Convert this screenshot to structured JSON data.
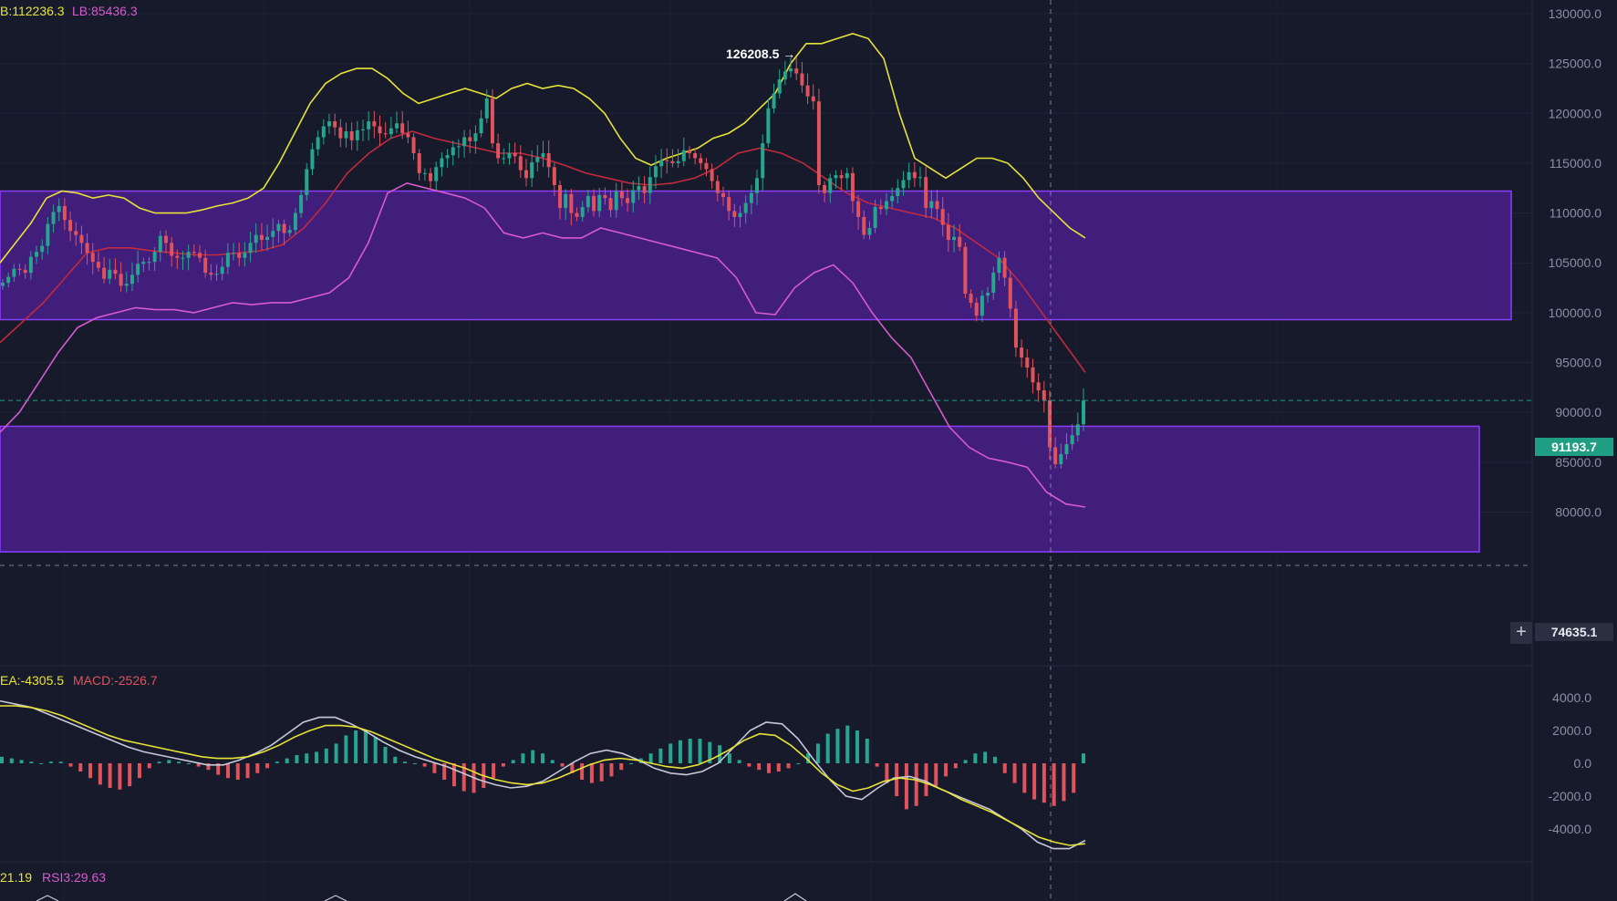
{
  "indicators": {
    "boll_label_ub": "B:112236.3",
    "boll_label_lb": "LB:85436.3",
    "macd_label_dea": "EA:-4305.5",
    "macd_label_macd": "MACD:-2526.7",
    "rsi_label_1": "21.19",
    "rsi_label_2": "RSI3:29.63"
  },
  "annotations": {
    "high_marker": "126208.5 →"
  },
  "price_tags": {
    "current_price": "91193.7",
    "crosshair_price": "74635.1",
    "crosshair_icon": "plus-icon"
  },
  "colors": {
    "background": "#161a2b",
    "up_candle": "#26a68e",
    "down_candle": "#e0525c",
    "upper_band": "#e8e337",
    "lower_band": "#d65ad0",
    "mid_band": "#c22a3e",
    "zone_fill": "#4a1f8f",
    "zone_border": "#8b3dff",
    "dif_line": "#c8c8d8",
    "dea_line": "#e8e337",
    "current_price_tag": "#1f9e84"
  },
  "chart_data": [
    {
      "type": "candlestick",
      "title": "",
      "ylim": [
        73000,
        131000
      ],
      "y_ticks": [
        "130000.0",
        "125000.0",
        "120000.0",
        "115000.0",
        "110000.0",
        "105000.0",
        "100000.0",
        "95000.0",
        "90000.0",
        "85000.0",
        "80000.0"
      ],
      "y_tick_values": [
        130000,
        125000,
        120000,
        115000,
        110000,
        105000,
        100000,
        95000,
        90000,
        85000,
        80000
      ],
      "zones": [
        {
          "from": 99300,
          "to": 112200
        },
        {
          "from": 76000,
          "to": 88600
        }
      ],
      "current_price": 91193.7,
      "crosshair_price": 74635.1,
      "high_annotation": 126208.5,
      "close": [
        103000,
        103600,
        104400,
        104300,
        104000,
        105600,
        106100,
        106700,
        108900,
        110100,
        110700,
        109300,
        108200,
        107800,
        107000,
        106000,
        105100,
        104500,
        103400,
        104300,
        103900,
        102700,
        102900,
        103800,
        104900,
        105100,
        105100,
        106100,
        107700,
        107000,
        105700,
        105500,
        105500,
        106100,
        106000,
        105500,
        104000,
        103800,
        103900,
        104600,
        106000,
        106000,
        105500,
        106000,
        107000,
        107800,
        107300,
        107600,
        108200,
        108900,
        108000,
        108300,
        110000,
        111800,
        114400,
        116400,
        117600,
        118700,
        119200,
        118600,
        117500,
        118200,
        117300,
        118300,
        118400,
        119200,
        118700,
        118000,
        117900,
        118500,
        119000,
        118000,
        117600,
        116000,
        114000,
        114000,
        113200,
        114600,
        115500,
        115800,
        116600,
        116700,
        117600,
        117200,
        118000,
        119500,
        121500,
        117000,
        115500,
        115500,
        116000,
        115700,
        114300,
        113500,
        115100,
        115600,
        116000,
        114600,
        112800,
        110500,
        111900,
        110000,
        109600,
        110600,
        111700,
        110200,
        111800,
        111500,
        110300,
        112200,
        111500,
        111000,
        112300,
        112700,
        112000,
        113600,
        114700,
        115300,
        115200,
        115000,
        115200,
        116300,
        116000,
        115500,
        115000,
        114400,
        113200,
        112000,
        111600,
        110200,
        109600,
        110000,
        111000,
        112000,
        113500,
        117000,
        120500,
        122000,
        123400,
        124200,
        124500,
        124000,
        122800,
        121700,
        121200,
        112800,
        112000,
        113500,
        113800,
        113500,
        114000,
        111200,
        109600,
        107800,
        108500,
        110600,
        110400,
        111200,
        111700,
        112500,
        113300,
        114100,
        113500,
        113600,
        110500,
        111200,
        110400,
        108800,
        107300,
        107600,
        106600,
        101900,
        101000,
        99700,
        101700,
        102000,
        104000,
        105500,
        103500,
        100400,
        96500,
        95500,
        94500,
        93000,
        92200,
        91200,
        86500,
        84800,
        85800,
        86800,
        87700,
        88800,
        91193.7
      ],
      "upper_band": [
        105000,
        107000,
        109000,
        111500,
        112200,
        112000,
        111500,
        111800,
        111500,
        110500,
        110000,
        110000,
        110000,
        110300,
        110700,
        111000,
        111500,
        112500,
        115000,
        118000,
        121000,
        123000,
        124000,
        124500,
        124500,
        123500,
        122000,
        121000,
        121500,
        122000,
        122500,
        122000,
        121500,
        122500,
        123000,
        122500,
        122800,
        122500,
        121500,
        120000,
        117500,
        115500,
        114800,
        115500,
        116000,
        116500,
        117500,
        118000,
        119000,
        120500,
        122000,
        125000,
        127000,
        127000,
        127500,
        128000,
        127500,
        125500,
        120000,
        115500,
        114500,
        113500,
        114500,
        115500,
        115500,
        115000,
        113500,
        111500,
        110000,
        108500,
        107500
      ],
      "lower_band": [
        88000,
        90000,
        93000,
        96000,
        98500,
        99500,
        100000,
        100500,
        100300,
        100300,
        100000,
        100500,
        101000,
        100800,
        101000,
        101000,
        101500,
        102000,
        103500,
        107000,
        112000,
        113000,
        112500,
        112000,
        111500,
        110500,
        108000,
        107500,
        108000,
        107500,
        107500,
        108500,
        108000,
        107500,
        107000,
        106500,
        106000,
        105500,
        103500,
        100000,
        99800,
        102500,
        104000,
        104800,
        103000,
        100000,
        97500,
        95500,
        92000,
        88500,
        86500,
        85400,
        85000,
        84500,
        82000,
        80800,
        80500
      ],
      "mid_band": [
        97000,
        99000,
        101000,
        103500,
        106000,
        106500,
        106500,
        106200,
        106000,
        105800,
        105800,
        106000,
        106200,
        106800,
        108500,
        111000,
        114000,
        116000,
        117500,
        118200,
        117500,
        117000,
        116500,
        116000,
        116000,
        115500,
        114800,
        114000,
        113500,
        113000,
        112800,
        113000,
        113500,
        114500,
        116000,
        116500,
        116000,
        115000,
        113500,
        112000,
        111000,
        110500,
        110000,
        109500,
        108500,
        107000,
        105500,
        103000,
        100000,
        97000,
        94000
      ]
    },
    {
      "type": "bar+line",
      "title": "MACD",
      "ylim": [
        -6500,
        6500
      ],
      "y_ticks": [
        "4000.0",
        "2000.0",
        "0.0",
        "-2000.0",
        "-4000.0"
      ],
      "y_tick_values": [
        4000,
        2000,
        0,
        -2000,
        -4000
      ],
      "histogram": [
        400,
        300,
        200,
        100,
        0,
        100,
        100,
        -200,
        -500,
        -900,
        -1300,
        -1500,
        -1600,
        -1400,
        -900,
        -300,
        100,
        200,
        100,
        0,
        -200,
        -400,
        -700,
        -900,
        -1000,
        -900,
        -600,
        -300,
        100,
        300,
        500,
        600,
        700,
        900,
        1200,
        1700,
        2000,
        2000,
        1600,
        1000,
        400,
        100,
        0,
        -200,
        -600,
        -1000,
        -1400,
        -1700,
        -1800,
        -1500,
        -900,
        -200,
        200,
        600,
        800,
        600,
        200,
        -200,
        -600,
        -1000,
        -1200,
        -1100,
        -800,
        -400,
        0,
        300,
        600,
        900,
        1200,
        1400,
        1500,
        1500,
        1300,
        1100,
        600,
        200,
        -200,
        -400,
        -600,
        -500,
        -300,
        0,
        600,
        1200,
        1800,
        2100,
        2300,
        2000,
        1500,
        -200,
        -1200,
        -2000,
        -2800,
        -2600,
        -2000,
        -1400,
        -800,
        -300,
        200,
        600,
        700,
        400,
        -600,
        -1200,
        -1800,
        -2200,
        -2400,
        -2600,
        -2300,
        -1800,
        600
      ],
      "dif": [
        3800,
        3600,
        3400,
        3000,
        2600,
        2200,
        1800,
        1400,
        1000,
        700,
        500,
        300,
        100,
        -100,
        -100,
        200,
        600,
        1100,
        1800,
        2500,
        2800,
        2800,
        2400,
        1900,
        1300,
        800,
        400,
        100,
        -200,
        -600,
        -1000,
        -1300,
        -1500,
        -1400,
        -1100,
        -500,
        100,
        600,
        800,
        600,
        200,
        -300,
        -600,
        -700,
        -500,
        0,
        1000,
        2000,
        2500,
        2400,
        1500,
        200,
        -1000,
        -2000,
        -2200,
        -1500,
        -900,
        -800,
        -1100,
        -1600,
        -2000,
        -2400,
        -2800,
        -3400,
        -4000,
        -4800,
        -5200,
        -5200,
        -4700
      ],
      "dea": [
        3500,
        3500,
        3400,
        3200,
        2900,
        2500,
        2100,
        1700,
        1400,
        1200,
        1000,
        800,
        600,
        400,
        300,
        300,
        400,
        700,
        1100,
        1600,
        2000,
        2300,
        2300,
        2200,
        1900,
        1500,
        1100,
        700,
        300,
        0,
        -300,
        -700,
        -1000,
        -1200,
        -1300,
        -1200,
        -900,
        -500,
        -100,
        200,
        300,
        200,
        0,
        -200,
        -300,
        -100,
        300,
        800,
        1400,
        1800,
        1700,
        1100,
        300,
        -600,
        -1300,
        -1700,
        -1500,
        -1100,
        -900,
        -1000,
        -1300,
        -1700,
        -2200,
        -2600,
        -3000,
        -3500,
        -4000,
        -4500,
        -4800,
        -5000,
        -4900
      ]
    },
    {
      "type": "line",
      "title": "RSI"
    }
  ]
}
